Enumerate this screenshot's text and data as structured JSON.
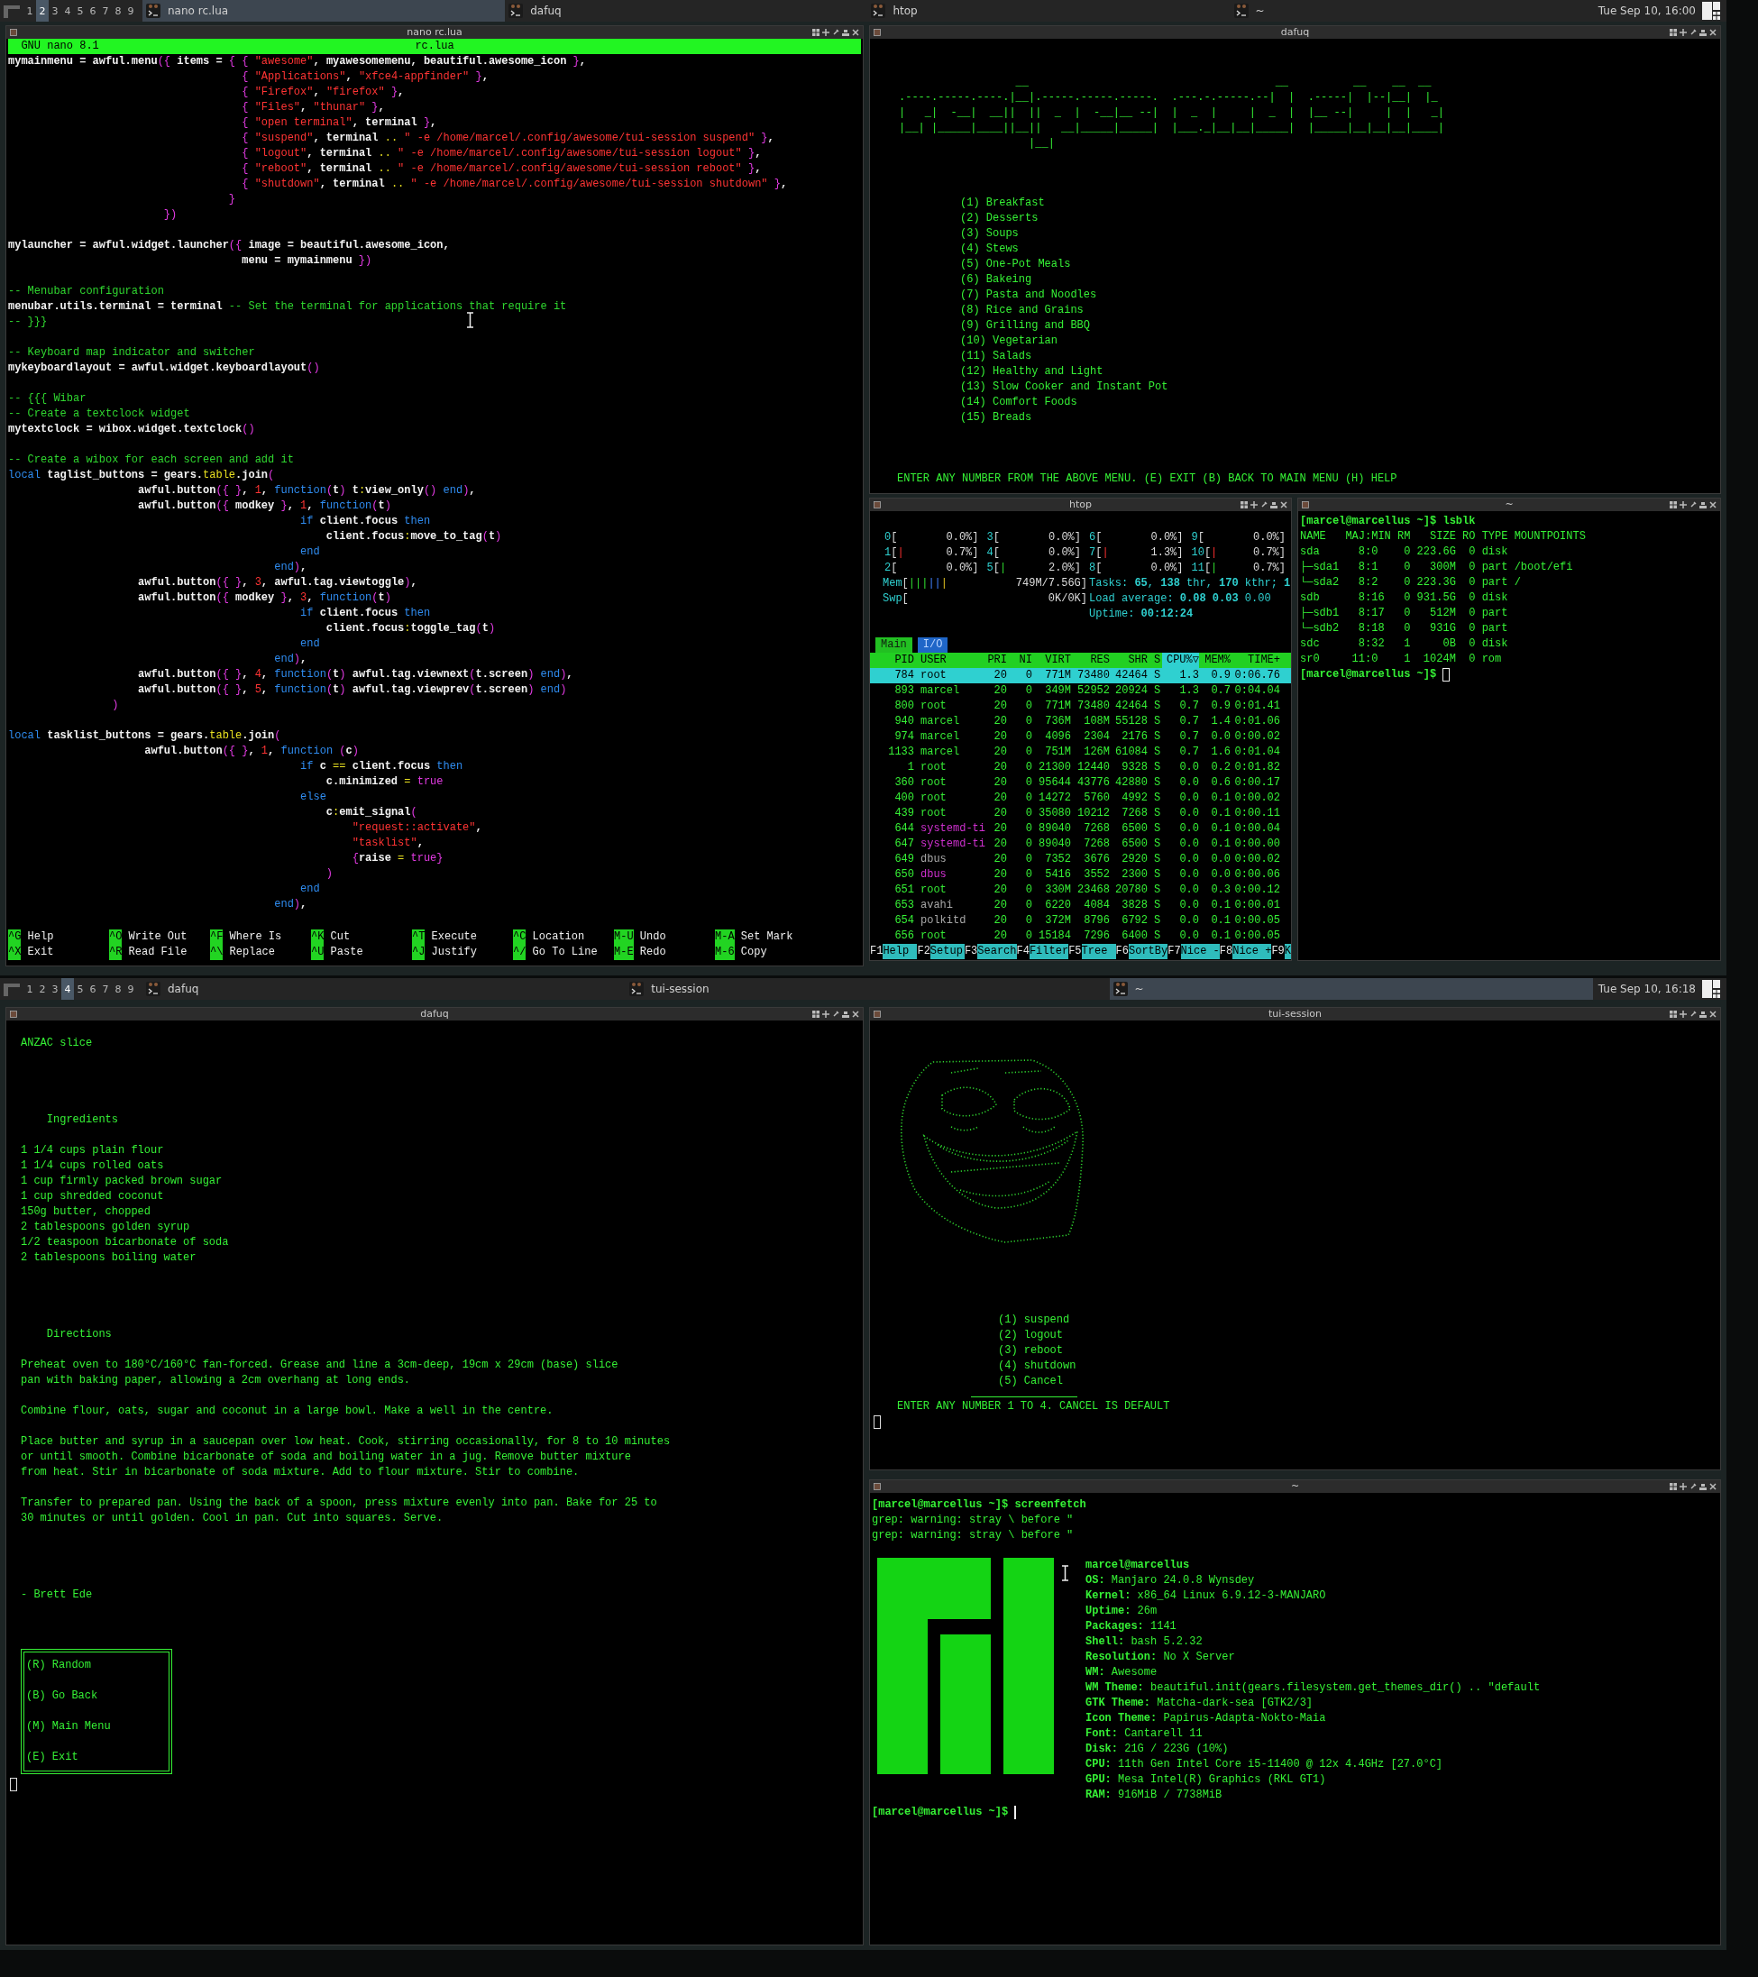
{
  "screens": [
    {
      "taskbar": {
        "tags": [
          {
            "label": "1",
            "selected": false
          },
          {
            "label": "2",
            "selected": true
          },
          {
            "label": "3",
            "selected": false
          },
          {
            "label": "4",
            "selected": false
          },
          {
            "label": "5",
            "selected": false
          },
          {
            "label": "6",
            "selected": false
          },
          {
            "label": "7",
            "selected": false
          },
          {
            "label": "8",
            "selected": false
          },
          {
            "label": "9",
            "selected": false
          }
        ],
        "tasks": [
          {
            "label": "nano rc.lua",
            "selected": true
          },
          {
            "label": "dafuq",
            "selected": false
          },
          {
            "label": "htop",
            "selected": false
          },
          {
            "label": "~",
            "selected": false
          }
        ],
        "clock": "Tue Sep 10, 16:00"
      }
    },
    {
      "taskbar": {
        "tags": [
          {
            "label": "1",
            "selected": false
          },
          {
            "label": "2",
            "selected": false
          },
          {
            "label": "3",
            "selected": false
          },
          {
            "label": "4",
            "selected": true
          },
          {
            "label": "5",
            "selected": false
          },
          {
            "label": "6",
            "selected": false
          },
          {
            "label": "7",
            "selected": false
          },
          {
            "label": "8",
            "selected": false
          },
          {
            "label": "9",
            "selected": false
          }
        ],
        "tasks": [
          {
            "label": "dafuq",
            "selected": false
          },
          {
            "label": "tui-session",
            "selected": false
          },
          {
            "label": "~",
            "selected": true
          }
        ],
        "clock": "Tue Sep 10, 16:18"
      }
    }
  ],
  "nano": {
    "title": "nano rc.lua",
    "app": "GNU nano 8.1",
    "file": "rc.lua",
    "blocks": [
      [
        [
          {
            "kind": "code",
            "text": "mymainmenu = awful.menu"
          },
          {
            "kind": "bracket",
            "text": "({"
          },
          {
            "kind": "code",
            "text": " items = "
          },
          {
            "kind": "bracket",
            "text": "{ {"
          },
          {
            "kind": "string",
            "text": " \"awesome\""
          },
          {
            "kind": "code",
            "text": ", myawesomemenu, beautiful.awesome_icon"
          },
          {
            "kind": "bracket",
            "text": " }"
          },
          {
            "kind": "code",
            "text": ","
          }
        ],
        [
          {
            "kind": "bracket",
            "text": "                                    {"
          },
          {
            "kind": "string",
            "text": " \"Applications\""
          },
          {
            "kind": "code",
            "text": ", "
          },
          {
            "kind": "string",
            "text": "\"xfce4-appfinder\""
          },
          {
            "kind": "bracket",
            "text": " }"
          },
          {
            "kind": "code",
            "text": ","
          }
        ],
        [
          {
            "kind": "bracket",
            "text": "                                    {"
          },
          {
            "kind": "string",
            "text": " \"Firefox\""
          },
          {
            "kind": "code",
            "text": ", "
          },
          {
            "kind": "string",
            "text": "\"firefox\""
          },
          {
            "kind": "bracket",
            "text": " }"
          },
          {
            "kind": "code",
            "text": ","
          }
        ],
        [
          {
            "kind": "bracket",
            "text": "                                    {"
          },
          {
            "kind": "string",
            "text": " \"Files\""
          },
          {
            "kind": "code",
            "text": ", "
          },
          {
            "kind": "string",
            "text": "\"thunar\""
          },
          {
            "kind": "bracket",
            "text": " }"
          },
          {
            "kind": "code",
            "text": ","
          }
        ],
        [
          {
            "kind": "bracket",
            "text": "                                    {"
          },
          {
            "kind": "string",
            "text": " \"open terminal\""
          },
          {
            "kind": "code",
            "text": ", terminal"
          },
          {
            "kind": "bracket",
            "text": " }"
          },
          {
            "kind": "code",
            "text": ","
          }
        ],
        [
          {
            "kind": "bracket",
            "text": "                                    {"
          },
          {
            "kind": "string",
            "text": " \"suspend\""
          },
          {
            "kind": "code",
            "text": ", terminal "
          },
          {
            "kind": "operator",
            "text": ".."
          },
          {
            "kind": "string",
            "text": " \" -e /home/marcel/.config/awesome/tui-session suspend\""
          },
          {
            "kind": "bracket",
            "text": " }"
          },
          {
            "kind": "code",
            "text": ","
          }
        ],
        [
          {
            "kind": "bracket",
            "text": "                                    {"
          },
          {
            "kind": "string",
            "text": " \"logout\""
          },
          {
            "kind": "code",
            "text": ", terminal "
          },
          {
            "kind": "operator",
            "text": ".."
          },
          {
            "kind": "string",
            "text": " \" -e /home/marcel/.config/awesome/tui-session logout\""
          },
          {
            "kind": "bracket",
            "text": " }"
          },
          {
            "kind": "code",
            "text": ","
          }
        ],
        [
          {
            "kind": "bracket",
            "text": "                                    {"
          },
          {
            "kind": "string",
            "text": " \"reboot\""
          },
          {
            "kind": "code",
            "text": ", terminal "
          },
          {
            "kind": "operator",
            "text": ".."
          },
          {
            "kind": "string",
            "text": " \" -e /home/marcel/.config/awesome/tui-session reboot\""
          },
          {
            "kind": "bracket",
            "text": " }"
          },
          {
            "kind": "code",
            "text": ","
          }
        ],
        [
          {
            "kind": "bracket",
            "text": "                                    {"
          },
          {
            "kind": "string",
            "text": " \"shutdown\""
          },
          {
            "kind": "code",
            "text": ", terminal "
          },
          {
            "kind": "operator",
            "text": ".."
          },
          {
            "kind": "string",
            "text": " \" -e /home/marcel/.config/awesome/tui-session shutdown\""
          },
          {
            "kind": "bracket",
            "text": " }"
          },
          {
            "kind": "code",
            "text": ","
          }
        ],
        [
          {
            "kind": "bracket",
            "text": "                                  }"
          }
        ],
        [
          {
            "kind": "bracket",
            "text": "                        })"
          }
        ]
      ],
      [
        [
          {
            "kind": "code",
            "text": "mylauncher = awful.widget.launcher"
          },
          {
            "kind": "bracket",
            "text": "({"
          },
          {
            "kind": "code",
            "text": " image = beautiful.awesome_icon,"
          }
        ],
        [
          {
            "kind": "code",
            "text": "                                    menu = mymainmenu"
          },
          {
            "kind": "bracket",
            "text": " })"
          }
        ]
      ],
      [
        [
          {
            "kind": "comment",
            "text": "-- Menubar configuration"
          }
        ],
        [
          {
            "kind": "code",
            "text": "menubar.utils.terminal = terminal"
          },
          {
            "kind": "comment",
            "text": " -- Set the terminal for applications that require it"
          }
        ],
        [
          {
            "kind": "comment",
            "text": "-- }}}"
          }
        ]
      ],
      [
        [
          {
            "kind": "comment",
            "text": "-- Keyboard map indicator and switcher"
          }
        ],
        [
          {
            "kind": "code",
            "text": "mykeyboardlayout = awful.widget.keyboardlayout"
          },
          {
            "kind": "bracket",
            "text": "()"
          }
        ]
      ],
      [
        [
          {
            "kind": "comment",
            "text": "-- {{{ Wibar"
          }
        ],
        [
          {
            "kind": "comment",
            "text": "-- Create a textclock widget"
          }
        ],
        [
          {
            "kind": "code",
            "text": "mytextclock = wibox.widget.textclock"
          },
          {
            "kind": "bracket",
            "text": "()"
          }
        ]
      ],
      [
        [
          {
            "kind": "comment",
            "text": "-- Create a wibox for each screen and add it"
          }
        ],
        [
          {
            "kind": "keyword",
            "text": "local"
          },
          {
            "kind": "code",
            "text": " taglist_buttons = gears."
          },
          {
            "kind": "operator",
            "text": "table"
          },
          {
            "kind": "code",
            "text": ".join"
          },
          {
            "kind": "bracket",
            "text": "("
          }
        ],
        [
          {
            "kind": "code",
            "text": "                    awful.button"
          },
          {
            "kind": "bracket",
            "text": "({ }"
          },
          {
            "kind": "code",
            "text": ", "
          },
          {
            "kind": "number",
            "text": "1"
          },
          {
            "kind": "code",
            "text": ", "
          },
          {
            "kind": "keyword",
            "text": "function"
          },
          {
            "kind": "bracket",
            "text": "("
          },
          {
            "kind": "code",
            "text": "t"
          },
          {
            "kind": "bracket",
            "text": ")"
          },
          {
            "kind": "code",
            "text": " t"
          },
          {
            "kind": "operator",
            "text": ":"
          },
          {
            "kind": "code",
            "text": "view_only"
          },
          {
            "kind": "bracket",
            "text": "()"
          },
          {
            "kind": "keyword",
            "text": " end"
          },
          {
            "kind": "bracket",
            "text": ")"
          },
          {
            "kind": "code",
            "text": ","
          }
        ],
        [
          {
            "kind": "code",
            "text": "                    awful.button"
          },
          {
            "kind": "bracket",
            "text": "({"
          },
          {
            "kind": "code",
            "text": " modkey"
          },
          {
            "kind": "bracket",
            "text": " }"
          },
          {
            "kind": "code",
            "text": ", "
          },
          {
            "kind": "number",
            "text": "1"
          },
          {
            "kind": "code",
            "text": ", "
          },
          {
            "kind": "keyword",
            "text": "function"
          },
          {
            "kind": "bracket",
            "text": "("
          },
          {
            "kind": "code",
            "text": "t"
          },
          {
            "kind": "bracket",
            "text": ")"
          }
        ],
        [
          {
            "kind": "keyword",
            "text": "                                             if"
          },
          {
            "kind": "code",
            "text": " client.focus"
          },
          {
            "kind": "keyword",
            "text": " then"
          }
        ],
        [
          {
            "kind": "code",
            "text": "                                                 client.focus"
          },
          {
            "kind": "operator",
            "text": ":"
          },
          {
            "kind": "code",
            "text": "move_to_tag"
          },
          {
            "kind": "bracket",
            "text": "("
          },
          {
            "kind": "code",
            "text": "t"
          },
          {
            "kind": "bracket",
            "text": ")"
          }
        ],
        [
          {
            "kind": "keyword",
            "text": "                                             end"
          }
        ],
        [
          {
            "kind": "keyword",
            "text": "                                         end"
          },
          {
            "kind": "bracket",
            "text": ")"
          },
          {
            "kind": "code",
            "text": ","
          }
        ],
        [
          {
            "kind": "code",
            "text": "                    awful.button"
          },
          {
            "kind": "bracket",
            "text": "({ }"
          },
          {
            "kind": "code",
            "text": ", "
          },
          {
            "kind": "number",
            "text": "3"
          },
          {
            "kind": "code",
            "text": ", awful.tag.viewtoggle"
          },
          {
            "kind": "bracket",
            "text": ")"
          },
          {
            "kind": "code",
            "text": ","
          }
        ],
        [
          {
            "kind": "code",
            "text": "                    awful.button"
          },
          {
            "kind": "bracket",
            "text": "({"
          },
          {
            "kind": "code",
            "text": " modkey"
          },
          {
            "kind": "bracket",
            "text": " }"
          },
          {
            "kind": "code",
            "text": ", "
          },
          {
            "kind": "number",
            "text": "3"
          },
          {
            "kind": "code",
            "text": ", "
          },
          {
            "kind": "keyword",
            "text": "function"
          },
          {
            "kind": "bracket",
            "text": "("
          },
          {
            "kind": "code",
            "text": "t"
          },
          {
            "kind": "bracket",
            "text": ")"
          }
        ],
        [
          {
            "kind": "keyword",
            "text": "                                             if"
          },
          {
            "kind": "code",
            "text": " client.focus"
          },
          {
            "kind": "keyword",
            "text": " then"
          }
        ],
        [
          {
            "kind": "code",
            "text": "                                                 client.focus"
          },
          {
            "kind": "operator",
            "text": ":"
          },
          {
            "kind": "code",
            "text": "toggle_tag"
          },
          {
            "kind": "bracket",
            "text": "("
          },
          {
            "kind": "code",
            "text": "t"
          },
          {
            "kind": "bracket",
            "text": ")"
          }
        ],
        [
          {
            "kind": "keyword",
            "text": "                                             end"
          }
        ],
        [
          {
            "kind": "keyword",
            "text": "                                         end"
          },
          {
            "kind": "bracket",
            "text": ")"
          },
          {
            "kind": "code",
            "text": ","
          }
        ],
        [
          {
            "kind": "code",
            "text": "                    awful.button"
          },
          {
            "kind": "bracket",
            "text": "({ }"
          },
          {
            "kind": "code",
            "text": ", "
          },
          {
            "kind": "number",
            "text": "4"
          },
          {
            "kind": "code",
            "text": ", "
          },
          {
            "kind": "keyword",
            "text": "function"
          },
          {
            "kind": "bracket",
            "text": "("
          },
          {
            "kind": "code",
            "text": "t"
          },
          {
            "kind": "bracket",
            "text": ")"
          },
          {
            "kind": "code",
            "text": " awful.tag.viewnext"
          },
          {
            "kind": "bracket",
            "text": "("
          },
          {
            "kind": "code",
            "text": "t.screen"
          },
          {
            "kind": "bracket",
            "text": ")"
          },
          {
            "kind": "keyword",
            "text": " end"
          },
          {
            "kind": "bracket",
            "text": ")"
          },
          {
            "kind": "code",
            "text": ","
          }
        ],
        [
          {
            "kind": "code",
            "text": "                    awful.button"
          },
          {
            "kind": "bracket",
            "text": "({ }"
          },
          {
            "kind": "code",
            "text": ", "
          },
          {
            "kind": "number",
            "text": "5"
          },
          {
            "kind": "code",
            "text": ", "
          },
          {
            "kind": "keyword",
            "text": "function"
          },
          {
            "kind": "bracket",
            "text": "("
          },
          {
            "kind": "code",
            "text": "t"
          },
          {
            "kind": "bracket",
            "text": ")"
          },
          {
            "kind": "code",
            "text": " awful.tag.viewprev"
          },
          {
            "kind": "bracket",
            "text": "("
          },
          {
            "kind": "code",
            "text": "t.screen"
          },
          {
            "kind": "bracket",
            "text": ")"
          },
          {
            "kind": "keyword",
            "text": " end"
          },
          {
            "kind": "bracket",
            "text": ")"
          }
        ],
        [
          {
            "kind": "bracket",
            "text": "                )"
          }
        ]
      ],
      [
        [
          {
            "kind": "keyword",
            "text": "local"
          },
          {
            "kind": "code",
            "text": " tasklist_buttons = gears."
          },
          {
            "kind": "operator",
            "text": "table"
          },
          {
            "kind": "code",
            "text": ".join"
          },
          {
            "kind": "bracket",
            "text": "("
          }
        ],
        [
          {
            "kind": "code",
            "text": "                     awful.button"
          },
          {
            "kind": "bracket",
            "text": "({ }"
          },
          {
            "kind": "code",
            "text": ", "
          },
          {
            "kind": "number",
            "text": "1"
          },
          {
            "kind": "code",
            "text": ", "
          },
          {
            "kind": "keyword",
            "text": "function"
          },
          {
            "kind": "bracket",
            "text": " ("
          },
          {
            "kind": "code",
            "text": "c"
          },
          {
            "kind": "bracket",
            "text": ")"
          }
        ],
        [
          {
            "kind": "keyword",
            "text": "                                             if"
          },
          {
            "kind": "code",
            "text": " c "
          },
          {
            "kind": "operator",
            "text": "=="
          },
          {
            "kind": "code",
            "text": " client.focus"
          },
          {
            "kind": "keyword",
            "text": " then"
          }
        ],
        [
          {
            "kind": "code",
            "text": "                                                 c.minimized "
          },
          {
            "kind": "operator",
            "text": "="
          },
          {
            "kind": "bracket",
            "text": " true"
          }
        ],
        [
          {
            "kind": "keyword",
            "text": "                                             else"
          }
        ],
        [
          {
            "kind": "code",
            "text": "                                                 c"
          },
          {
            "kind": "operator",
            "text": ":"
          },
          {
            "kind": "code",
            "text": "emit_signal"
          },
          {
            "kind": "bracket",
            "text": "("
          }
        ],
        [
          {
            "kind": "string",
            "text": "                                                     \"request::activate\""
          },
          {
            "kind": "code",
            "text": ","
          }
        ],
        [
          {
            "kind": "string",
            "text": "                                                     \"tasklist\""
          },
          {
            "kind": "code",
            "text": ","
          }
        ],
        [
          {
            "kind": "bracket",
            "text": "                                                     {"
          },
          {
            "kind": "code",
            "text": "raise "
          },
          {
            "kind": "operator",
            "text": "="
          },
          {
            "kind": "bracket",
            "text": " true}"
          }
        ],
        [
          {
            "kind": "bracket",
            "text": "                                                 )"
          }
        ],
        [
          {
            "kind": "keyword",
            "text": "                                             end"
          }
        ],
        [
          {
            "kind": "keyword",
            "text": "                                         end"
          },
          {
            "kind": "bracket",
            "text": ")"
          },
          {
            "kind": "code",
            "text": ","
          }
        ]
      ]
    ],
    "shortcuts": [
      {
        "key": "^G",
        "label": "Help"
      },
      {
        "key": "^O",
        "label": "Write Out"
      },
      {
        "key": "^F",
        "label": "Where Is"
      },
      {
        "key": "^K",
        "label": "Cut"
      },
      {
        "key": "^T",
        "label": "Execute"
      },
      {
        "key": "^C",
        "label": "Location"
      },
      {
        "key": "M-U",
        "label": "Undo"
      },
      {
        "key": "M-A",
        "label": "Set Mark"
      },
      {
        "key": "^X",
        "label": "Exit"
      },
      {
        "key": "^R",
        "label": "Read File"
      },
      {
        "key": "^\\",
        "label": "Replace"
      },
      {
        "key": "^U",
        "label": "Paste"
      },
      {
        "key": "^J",
        "label": "Justify"
      },
      {
        "key": "^/",
        "label": "Go To Line"
      },
      {
        "key": "M-E",
        "label": "Redo"
      },
      {
        "key": "M-6",
        "label": "Copy"
      }
    ]
  },
  "recipes_menu": {
    "title": "dafuq",
    "banner": [
      "                  __                                      __          __    __  __",
      ".----.-----.----.|__|.-----.-----.-----.  .---.-.-----.--|  |  .-----|  |--|__|  |_",
      "|   _|  -__|  __||  ||  _  |  -__|__ --|  |  _  |     |  _  |  |__ --|     |  |   _|",
      "|__| |_____|____||__||   __|_____|_____|  |___._|__|__|_____|  |_____|__|__|__|____|",
      "                    |__|"
    ],
    "items": [
      "(1) Breakfast",
      "(2) Desserts",
      "(3) Soups",
      "(4) Stews",
      "(5) One-Pot Meals",
      "(6) Bakeing",
      "(7) Pasta and Noodles",
      "(8) Rice and Grains",
      "(9) Grilling and BBQ",
      "(10) Vegetarian",
      "(11) Salads",
      "(12) Healthy and Light",
      "(13) Slow Cooker and Instant Pot",
      "(14) Comfort Foods",
      "(15) Breads"
    ],
    "prompt": "ENTER ANY NUMBER FROM THE ABOVE MENU. (E) EXIT (B) BACK TO MAIN MENU (H) HELP"
  },
  "htop": {
    "title": "htop",
    "cpus": [
      {
        "label": "0",
        "bracket": "[",
        "value": "0.0%]"
      },
      {
        "label": "3",
        "bracket": "[",
        "value": "0.0%]"
      },
      {
        "label": "6",
        "bracket": "[",
        "value": "0.0%]"
      },
      {
        "label": "9",
        "bracket": "[",
        "value": "0.0%]"
      },
      {
        "label": "1",
        "bracket": "[",
        "bar": "|",
        "kind": "kernel",
        "value": "0.7%]"
      },
      {
        "label": "4",
        "bracket": "[",
        "value": "0.0%]"
      },
      {
        "label": "7",
        "bracket": "[",
        "bar": "|",
        "kind": "kernel",
        "value": "1.3%]"
      },
      {
        "label": "10",
        "bracket": "[",
        "bar": "|",
        "kind": "kernel",
        "value": "0.7%]"
      },
      {
        "label": "2",
        "bracket": "[",
        "value": "0.0%]"
      },
      {
        "label": "5",
        "bracket": "[",
        "bar": "|",
        "kind": "user",
        "value": "2.0%]"
      },
      {
        "label": "8",
        "bracket": "[",
        "value": "0.0%]"
      },
      {
        "label": "11",
        "bracket": "[",
        "bar": "|",
        "kind": "user",
        "value": "0.7%]"
      }
    ],
    "memory": {
      "label": "Mem",
      "bracket": "[",
      "bars": [
        {
          "text": "|||",
          "kind": "used"
        },
        {
          "text": "||",
          "kind": "buffers"
        },
        {
          "text": "|",
          "kind": "cache"
        }
      ],
      "value": "749M/7.56G]"
    },
    "swap": {
      "label": "Swp",
      "bracket": "[",
      "value": "0K/0K]"
    },
    "tasks": "Tasks: **65**, **138** thr, **170** kthr; **1**",
    "load": "Load average: **0.08** **0.03** 0.00",
    "uptime": "Uptime: **00:12:24**",
    "tabs": [
      {
        "label": "Main",
        "selected": true
      },
      {
        "label": "I/O",
        "selected": false
      }
    ],
    "columns": [
      {
        "label": "PID",
        "sorted": false
      },
      {
        "label": "USER",
        "sorted": false
      },
      {
        "label": "PRI",
        "sorted": false
      },
      {
        "label": "NI",
        "sorted": false
      },
      {
        "label": "VIRT",
        "sorted": false
      },
      {
        "label": "RES",
        "sorted": false
      },
      {
        "label": "SHR",
        "sorted": false
      },
      {
        "label": "S",
        "sorted": false
      },
      {
        "label": "CPU%▽",
        "sorted": true
      },
      {
        "label": "MEM%",
        "sorted": false
      },
      {
        "label": "TIME+",
        "sorted": false
      }
    ],
    "rows": [
      {
        "cells": [
          "784",
          "root",
          "20",
          "0",
          "771M",
          "73480",
          "42464",
          "S",
          "1.3",
          "0.9",
          "0:06.76"
        ],
        "selected": true
      },
      {
        "cells": [
          "893",
          "marcel",
          "20",
          "0",
          "349M",
          "52952",
          "20924",
          "S",
          "1.3",
          "0.7",
          "0:04.04"
        ],
        "selected": false,
        "color": "#35e835"
      },
      {
        "cells": [
          "800",
          "root",
          "20",
          "0",
          "771M",
          "73480",
          "42464",
          "S",
          "0.7",
          "0.9",
          "0:01.41"
        ],
        "selected": false,
        "color": "#35e835"
      },
      {
        "cells": [
          "940",
          "marcel",
          "20",
          "0",
          "736M",
          "108M",
          "55128",
          "S",
          "0.7",
          "1.4",
          "0:01.06"
        ],
        "selected": false,
        "color": "#35e835"
      },
      {
        "cells": [
          "974",
          "marcel",
          "20",
          "0",
          "4096",
          "2304",
          "2176",
          "S",
          "0.7",
          "0.0",
          "0:00.02"
        ],
        "selected": false,
        "color": "#35e835"
      },
      {
        "cells": [
          "1133",
          "marcel",
          "20",
          "0",
          "751M",
          "126M",
          "61084",
          "S",
          "0.7",
          "1.6",
          "0:01.04"
        ],
        "selected": false,
        "color": "#35e835"
      },
      {
        "cells": [
          "1",
          "root",
          "20",
          "0",
          "21300",
          "12440",
          "9328",
          "S",
          "0.0",
          "0.2",
          "0:01.82"
        ],
        "selected": false,
        "color": "#35e835"
      },
      {
        "cells": [
          "360",
          "root",
          "20",
          "0",
          "95644",
          "43776",
          "42880",
          "S",
          "0.0",
          "0.6",
          "0:00.17"
        ],
        "selected": false,
        "color": "#35e835"
      },
      {
        "cells": [
          "400",
          "root",
          "20",
          "0",
          "14272",
          "5760",
          "4992",
          "S",
          "0.0",
          "0.1",
          "0:00.02"
        ],
        "selected": false,
        "color": "#35e835"
      },
      {
        "cells": [
          "439",
          "root",
          "20",
          "0",
          "35080",
          "10212",
          "7268",
          "S",
          "0.0",
          "0.1",
          "0:00.11"
        ],
        "selected": false,
        "color": "#35e835"
      },
      {
        "cells": [
          "644",
          "systemd-ti",
          "20",
          "0",
          "89040",
          "7268",
          "6500",
          "S",
          "0.0",
          "0.1",
          "0:00.04"
        ],
        "selected": false,
        "color": "#d030d0"
      },
      {
        "cells": [
          "647",
          "systemd-ti",
          "20",
          "0",
          "89040",
          "7268",
          "6500",
          "S",
          "0.0",
          "0.1",
          "0:00.00"
        ],
        "selected": false,
        "color": "#d030d0"
      },
      {
        "cells": [
          "649",
          "dbus",
          "20",
          "0",
          "7352",
          "3676",
          "2920",
          "S",
          "0.0",
          "0.0",
          "0:00.02"
        ],
        "selected": false,
        "color": "#a8a8a8"
      },
      {
        "cells": [
          "650",
          "dbus",
          "20",
          "0",
          "5416",
          "3552",
          "2300",
          "S",
          "0.0",
          "0.0",
          "0:00.06"
        ],
        "selected": false,
        "color": "#d030d0"
      },
      {
        "cells": [
          "651",
          "root",
          "20",
          "0",
          "330M",
          "23468",
          "20780",
          "S",
          "0.0",
          "0.3",
          "0:00.12"
        ],
        "selected": false,
        "color": "#35e835"
      },
      {
        "cells": [
          "653",
          "avahi",
          "20",
          "0",
          "6220",
          "4084",
          "3828",
          "S",
          "0.0",
          "0.1",
          "0:00.01"
        ],
        "selected": false,
        "color": "#a8a8a8"
      },
      {
        "cells": [
          "654",
          "polkitd",
          "20",
          "0",
          "372M",
          "8796",
          "6792",
          "S",
          "0.0",
          "0.1",
          "0:00.05"
        ],
        "selected": false,
        "color": "#a8a8a8"
      },
      {
        "cells": [
          "656",
          "root",
          "20",
          "0",
          "15184",
          "7296",
          "6400",
          "S",
          "0.0",
          "0.1",
          "0:00.05"
        ],
        "selected": false,
        "color": "#35e835"
      }
    ],
    "fkeys": [
      {
        "key": "F1",
        "label": "Help"
      },
      {
        "key": "F2",
        "label": "Setup"
      },
      {
        "key": "F3",
        "label": "Search"
      },
      {
        "key": "F4",
        "label": "Filter"
      },
      {
        "key": "F5",
        "label": "Tree"
      },
      {
        "key": "F6",
        "label": "SortBy"
      },
      {
        "key": "F7",
        "label": "Nice -"
      },
      {
        "key": "F8",
        "label": "Nice +"
      },
      {
        "key": "F9",
        "label": "K"
      }
    ]
  },
  "lsblk": {
    "title": "~",
    "prompt": "[marcel@marcellus ~]$ lsblk",
    "lines": [
      "NAME   MAJ:MIN RM   SIZE RO TYPE MOUNTPOINTS",
      "sda      8:0    0 223.6G  0 disk",
      "├─sda1   8:1    0   300M  0 part /boot/efi",
      "└─sda2   8:2    0 223.3G  0 part /",
      "sdb      8:16   0 931.5G  0 disk",
      "├─sdb1   8:17   0   512M  0 part",
      "└─sdb2   8:18   0   931G  0 part",
      "sdc      8:32   1     0B  0 disk",
      "sr0     11:0    1  1024M  0 rom"
    ],
    "prompt_end": "[marcel@marcellus ~]$"
  },
  "recipe": {
    "title": "dafuq",
    "name": "ANZAC slice",
    "ingredients_heading": "Ingredients",
    "ingredients": [
      "1 1/4 cups plain flour",
      "1 1/4 cups rolled oats",
      "1 cup firmly packed brown sugar",
      "1 cup shredded coconut",
      "150g butter, chopped",
      "2 tablespoons golden syrup",
      "1/2 teaspoon bicarbonate of soda",
      "2 tablespoons boiling water"
    ],
    "directions_heading": "Directions",
    "directions": [
      [
        "Preheat oven to 180°C/160°C fan-forced. Grease and line a 3cm-deep, 19cm x 29cm (base) slice",
        "pan with baking paper, allowing a 2cm overhang at long ends."
      ],
      [
        "Combine flour, oats, sugar and coconut in a large bowl. Make a well in the centre."
      ],
      [
        "Place butter and syrup in a saucepan over low heat. Cook, stirring occasionally, for 8 to 10 minutes",
        "or until smooth. Combine bicarbonate of soda and boiling water in a jug. Remove butter mixture",
        "from heat. Stir in bicarbonate of soda mixture. Add to flour mixture. Stir to combine."
      ],
      [
        "Transfer to prepared pan. Using the back of a spoon, press mixture evenly into pan. Bake for 25 to",
        "30 minutes or until golden. Cool in pan. Cut into squares. Serve."
      ]
    ],
    "author": "- Brett Ede",
    "options": [
      "(R) Random",
      "(B) Go Back",
      "(M) Main Menu",
      "(E) Exit"
    ]
  },
  "session": {
    "title": "tui-session",
    "items": [
      "(1) suspend",
      "(2) logout",
      "(3) reboot",
      "(4) shutdown",
      "(5) Cancel"
    ],
    "prompt": "ENTER ANY NUMBER 1 TO 4. CANCEL IS DEFAULT"
  },
  "fetch": {
    "title": "~",
    "command": "[marcel@marcellus ~]$ screenfetch",
    "warnings": [
      "grep: warning: stray \\ before \"",
      "grep: warning: stray \\ before \""
    ],
    "user": "marcel@marcellus",
    "info": [
      "**OS:** Manjaro 24.0.8 Wynsdey",
      "**Kernel:** x86_64 Linux 6.9.12-3-MANJARO",
      "**Uptime:** 26m",
      "**Packages:** 1141",
      "**Shell:** bash 5.2.32",
      "**Resolution:** No X Server",
      "**WM:** Awesome",
      "**WM Theme:** beautiful.init(gears.filesystem.get_themes_dir() .. \"default",
      "**GTK Theme:** Matcha-dark-sea [GTK2/3]",
      "**Icon Theme:** Papirus-Adapta-Nokto-Maia",
      "**Font:** Cantarell 11",
      "**Disk:** 21G / 223G (10%)",
      "**CPU:** 11th Gen Intel Core i5-11400 @ 12x 4.4GHz [27.0°C]",
      "**GPU:** Mesa Intel(R) Graphics (RKL GT1)",
      "**RAM:** 916MiB / 7738MiB"
    ],
    "prompt": "[marcel@marcellus ~]$"
  }
}
